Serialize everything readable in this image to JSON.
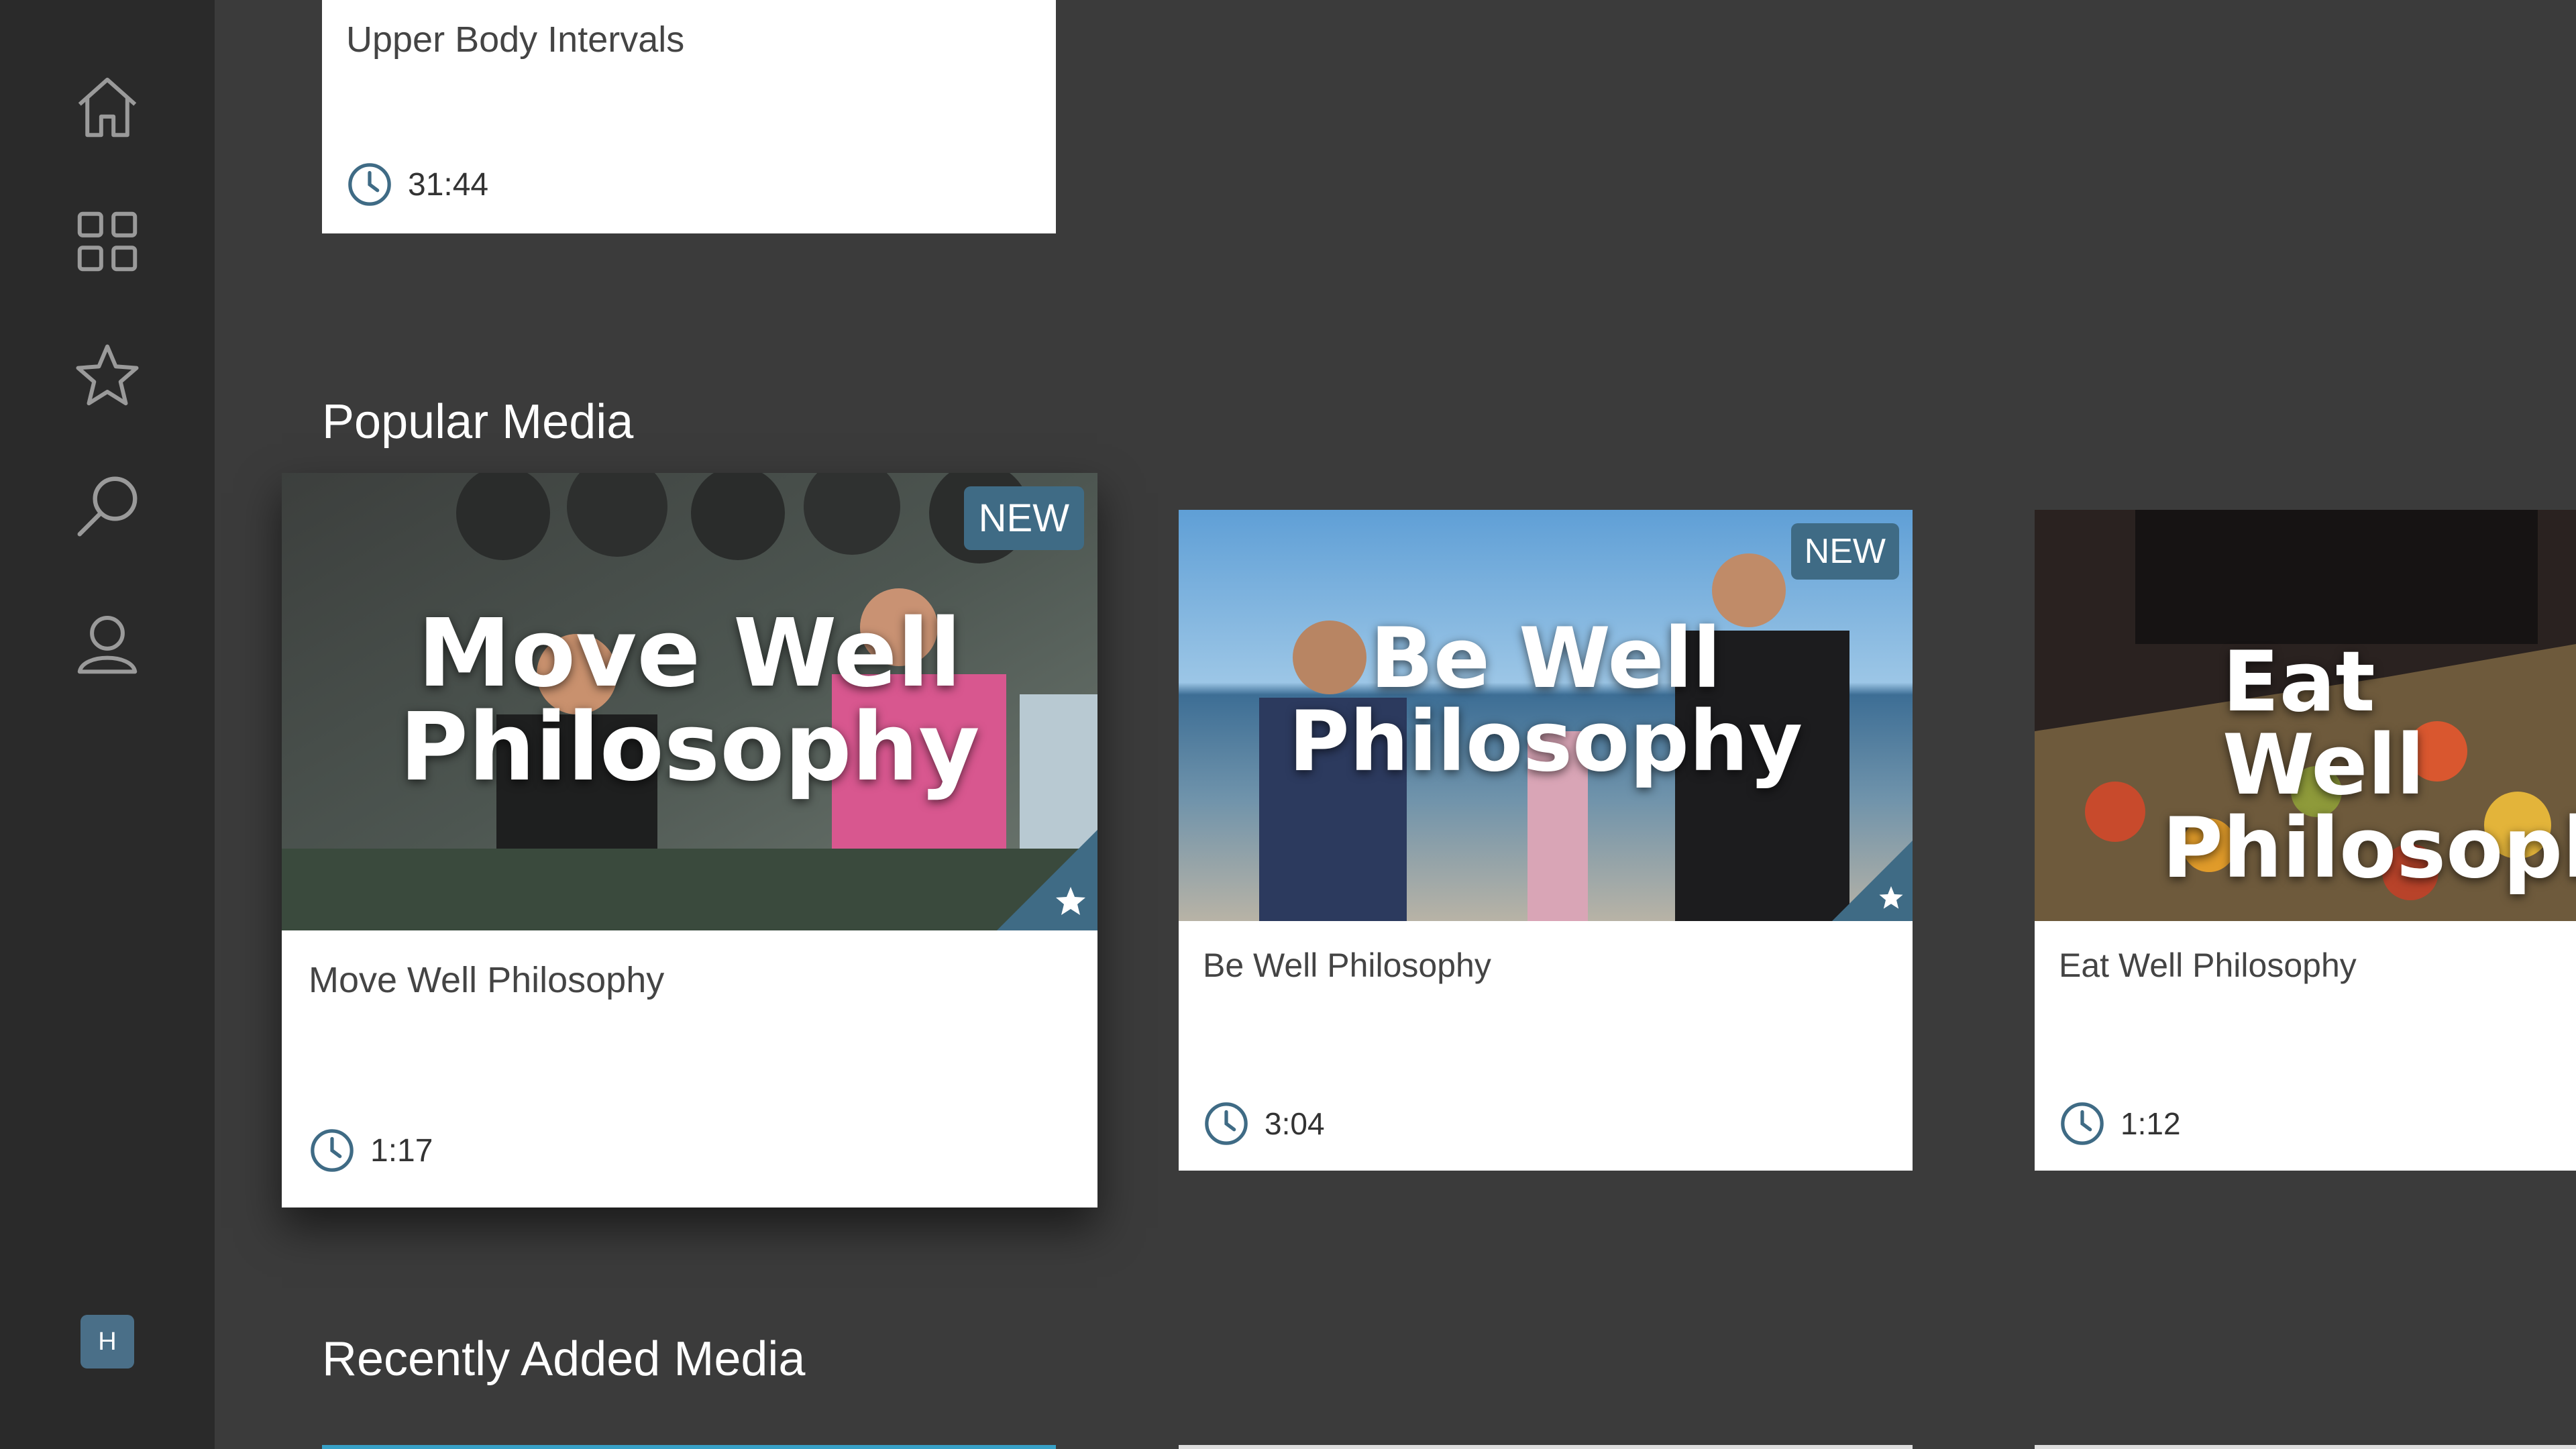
{
  "sidebar": {
    "nav": [
      {
        "icon": "home-icon"
      },
      {
        "icon": "grid-icon"
      },
      {
        "icon": "star-icon"
      },
      {
        "icon": "search-icon"
      },
      {
        "icon": "profile-icon"
      }
    ],
    "user_initial": "H"
  },
  "top_card": {
    "title": "Upper Body Intervals",
    "duration": "31:44"
  },
  "popular": {
    "title": "Popular Media",
    "cards": [
      {
        "title": "Move Well Philosophy",
        "thumb_line1": "Move Well",
        "thumb_line2": "Philosophy",
        "badge": "NEW",
        "duration": "1:17"
      },
      {
        "title": "Be Well Philosophy",
        "thumb_line1": "Be Well",
        "thumb_line2": "Philosophy",
        "badge": "NEW",
        "duration": "3:04"
      },
      {
        "title": "Eat Well Philosophy",
        "thumb_line1": "Eat Well",
        "thumb_line2": "Philosoph",
        "duration": "1:12"
      }
    ]
  },
  "recent": {
    "title": "Recently Added Media"
  },
  "colors": {
    "accent": "#3f6b85",
    "background": "#3b3b3b",
    "sidebar": "#2a2a2a"
  }
}
